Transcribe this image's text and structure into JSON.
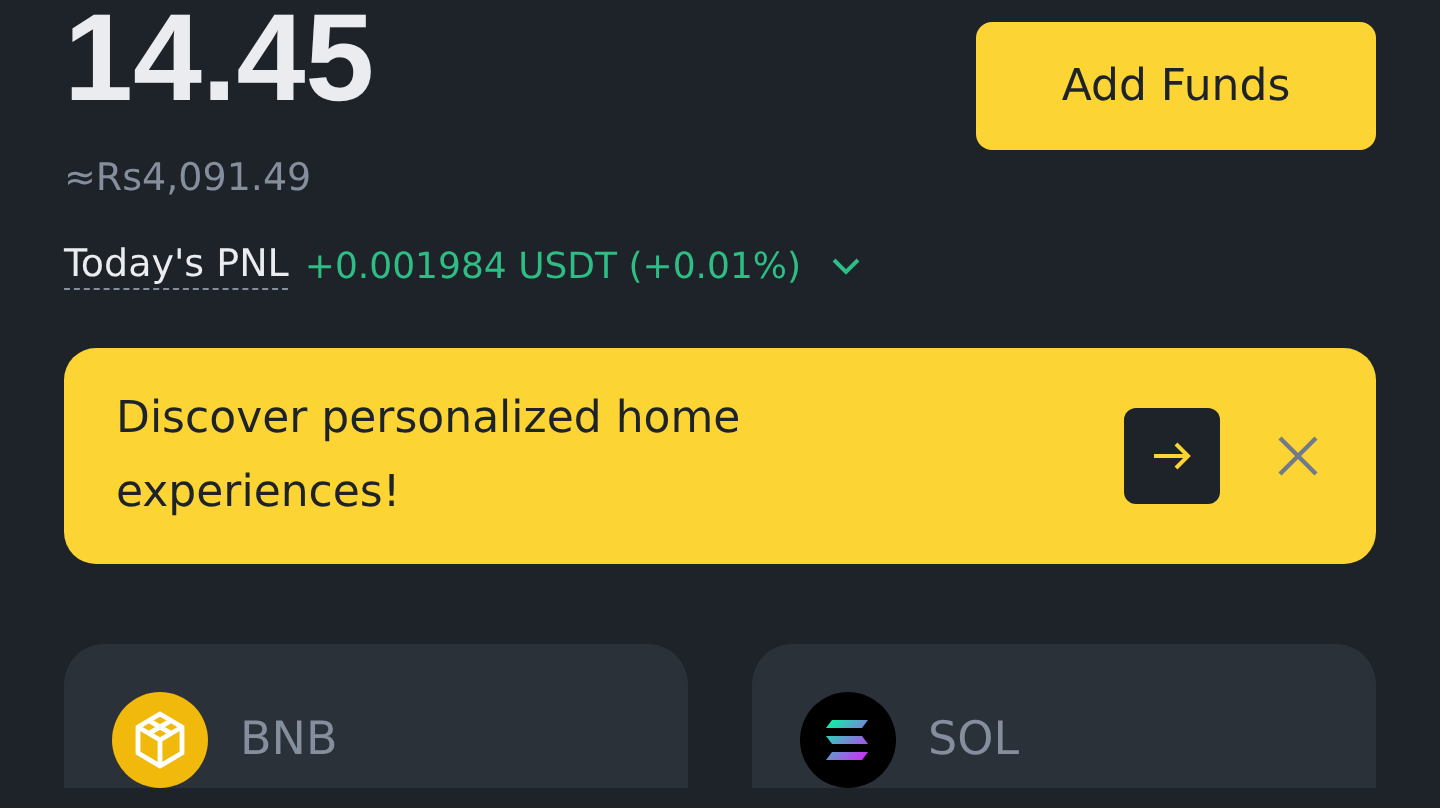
{
  "balance": {
    "amount": "14.45",
    "fiat": "≈Rs4,091.49"
  },
  "add_funds_button": "Add Funds",
  "pnl": {
    "label": "Today's PNL",
    "value": "+0.001984 USDT (+0.01%)",
    "expanded": false
  },
  "banner": {
    "text": "Discover personalized home experiences!"
  },
  "coins": [
    {
      "kind": "bnb",
      "symbol": "BNB"
    },
    {
      "kind": "sol",
      "symbol": "SOL"
    }
  ]
}
